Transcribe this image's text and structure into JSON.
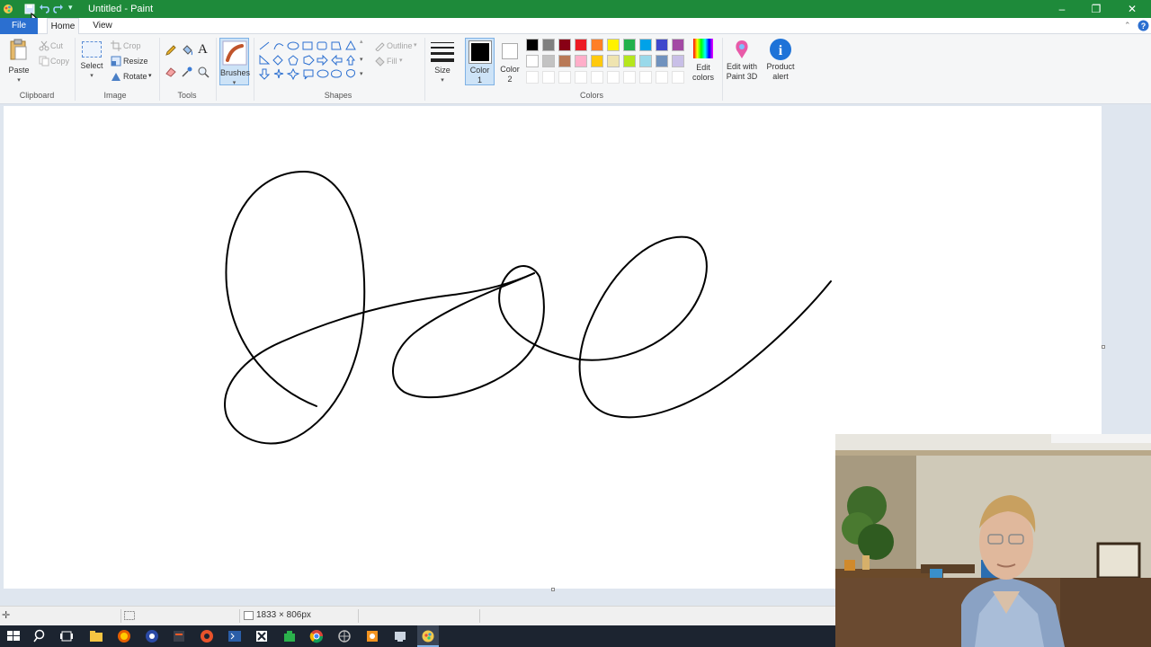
{
  "window": {
    "title": "Untitled - Paint"
  },
  "tabs": {
    "file": "File",
    "home": "Home",
    "view": "View"
  },
  "ribbon": {
    "clipboard": {
      "paste": "Paste",
      "cut": "Cut",
      "copy": "Copy",
      "label": "Clipboard"
    },
    "image": {
      "select": "Select",
      "crop": "Crop",
      "resize": "Resize",
      "rotate": "Rotate",
      "label": "Image"
    },
    "tools": {
      "label": "Tools"
    },
    "brushes": {
      "label": "Brushes"
    },
    "shapes": {
      "label": "Shapes",
      "outline": "Outline",
      "fill": "Fill"
    },
    "size": {
      "label": "Size"
    },
    "colors": {
      "color1_line1": "Color",
      "color1_line2": "1",
      "color2_line1": "Color",
      "color2_line2": "2",
      "edit_line1": "Edit",
      "edit_line2": "colors",
      "label": "Colors",
      "palette_row1": [
        "#000000",
        "#7f7f7f",
        "#880015",
        "#ed1c24",
        "#ff7f27",
        "#fff200",
        "#22b14c",
        "#00a2e8",
        "#3f48cc",
        "#a349a4"
      ],
      "palette_row2": [
        "#ffffff",
        "#c3c3c3",
        "#b97a57",
        "#ffaec9",
        "#ffc90e",
        "#efe4b0",
        "#b5e61d",
        "#99d9ea",
        "#7092be",
        "#c8bfe7"
      ]
    },
    "paint3d": {
      "line1": "Edit with",
      "line2": "Paint 3D"
    },
    "product_alert": {
      "line1": "Product",
      "line2": "alert"
    }
  },
  "status": {
    "canvas_size": "1833 × 806px"
  },
  "colors": {
    "titlebar": "#1e8a3a",
    "accent": "#2b6fd0"
  }
}
